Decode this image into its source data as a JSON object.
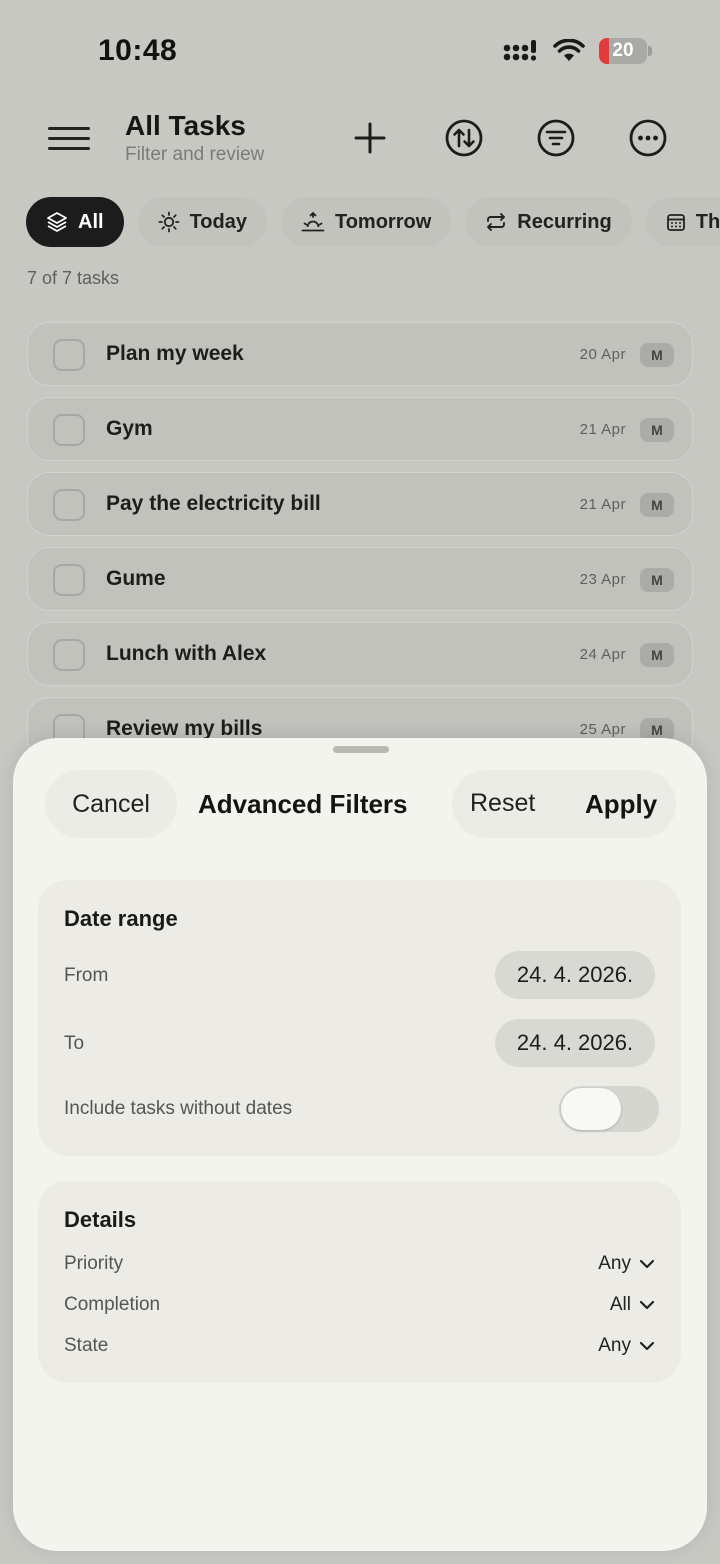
{
  "status": {
    "time": "10:48",
    "battery": "20",
    "battery_level": 0.2,
    "battery_color": "#e23b3b"
  },
  "header": {
    "title": "All Tasks",
    "subtitle": "Filter and review"
  },
  "chips": [
    {
      "label": "All",
      "icon": "layers-icon",
      "active": true
    },
    {
      "label": "Today",
      "icon": "sun-icon",
      "active": false
    },
    {
      "label": "Tomorrow",
      "icon": "sunrise-icon",
      "active": false
    },
    {
      "label": "Recurring",
      "icon": "repeat-icon",
      "active": false
    },
    {
      "label": "This",
      "icon": "calendar-icon",
      "active": false
    }
  ],
  "count_text": "7 of 7 tasks",
  "tasks": [
    {
      "name": "Plan my week",
      "date": "20 Apr",
      "badge": "M"
    },
    {
      "name": "Gym",
      "date": "21 Apr",
      "badge": "M"
    },
    {
      "name": "Pay the electricity bill",
      "date": "21 Apr",
      "badge": "M"
    },
    {
      "name": "Gume",
      "date": "23 Apr",
      "badge": "M"
    },
    {
      "name": "Lunch with Alex",
      "date": "24 Apr",
      "badge": "M"
    },
    {
      "name": "Review my bills",
      "date": "25 Apr",
      "badge": "M"
    }
  ],
  "sheet": {
    "cancel": "Cancel",
    "title": "Advanced Filters",
    "reset": "Reset",
    "apply": "Apply",
    "date_range": {
      "title": "Date range",
      "from_label": "From",
      "from_value": "24. 4. 2026.",
      "to_label": "To",
      "to_value": "24. 4. 2026.",
      "include_label": "Include tasks without dates",
      "include_on": false
    },
    "details": {
      "title": "Details",
      "priority_label": "Priority",
      "priority_value": "Any",
      "completion_label": "Completion",
      "completion_value": "All",
      "state_label": "State",
      "state_value": "Any"
    }
  }
}
